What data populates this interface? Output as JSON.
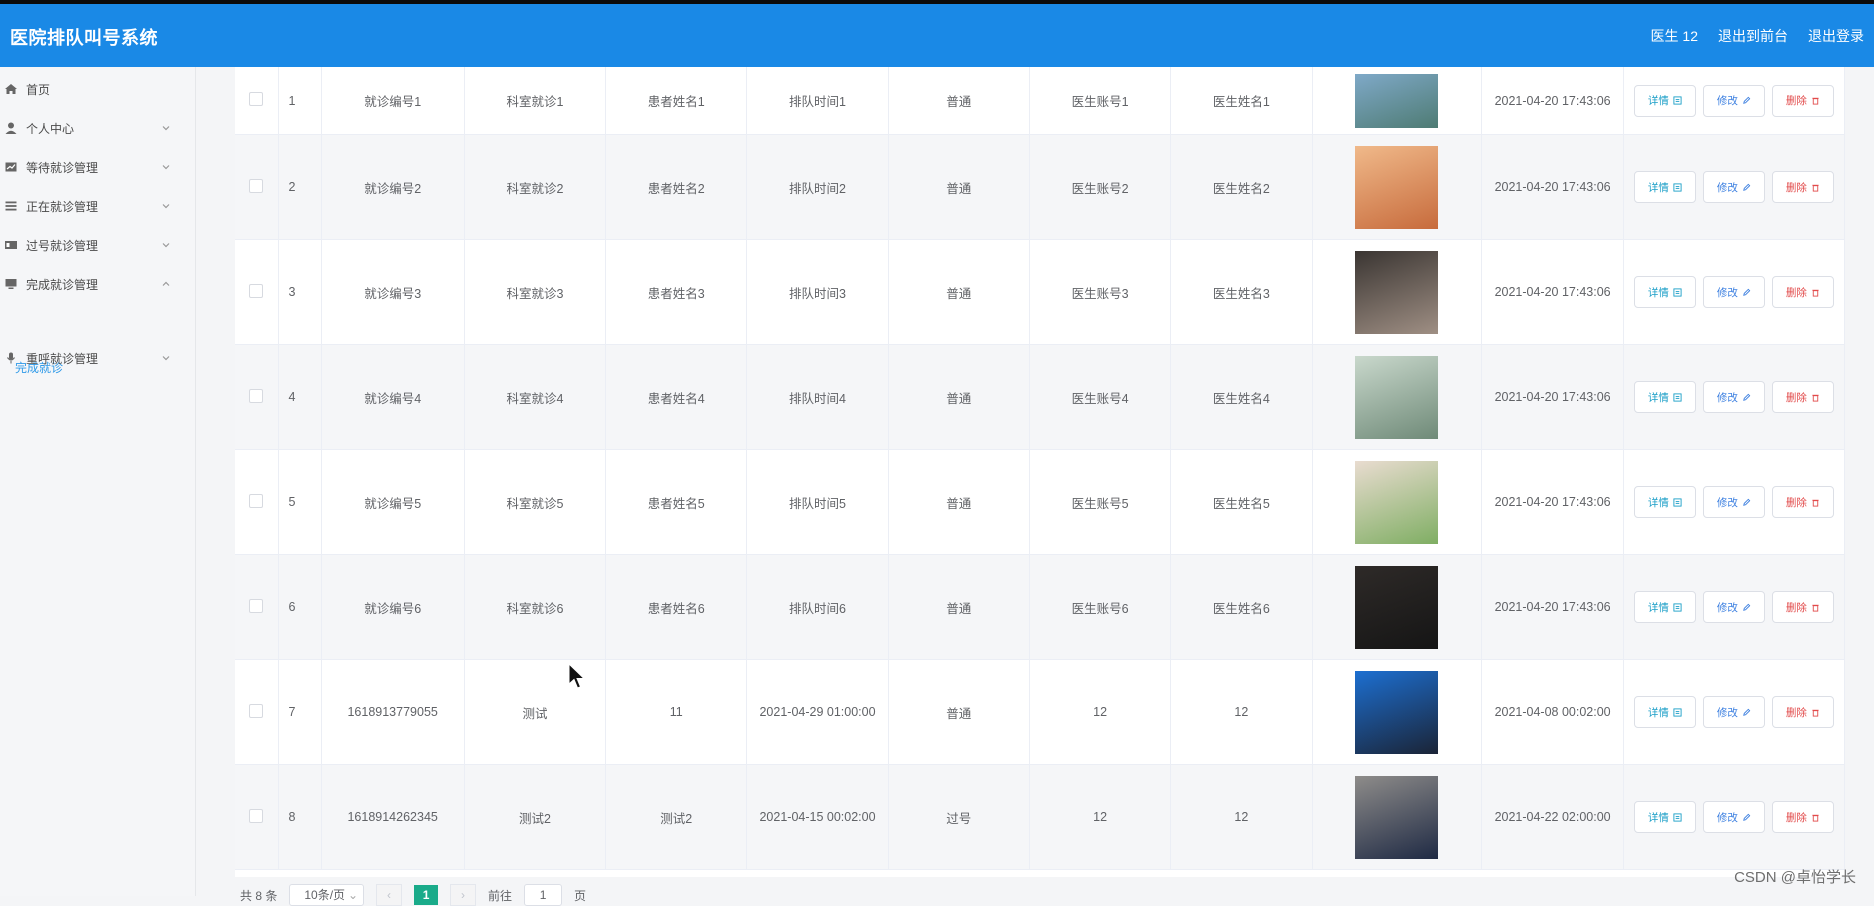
{
  "app": {
    "title": "医院排队叫号系统"
  },
  "header": {
    "user": "医生 12",
    "to_front": "退出到前台",
    "logout": "退出登录"
  },
  "sidebar": {
    "items": [
      {
        "label": "首页",
        "icon": "home-icon"
      },
      {
        "label": "个人中心",
        "icon": "user-icon"
      },
      {
        "label": "等待就诊管理",
        "icon": "chart-icon"
      },
      {
        "label": "正在就诊管理",
        "icon": "list-icon"
      },
      {
        "label": "过号就诊管理",
        "icon": "card-icon"
      },
      {
        "label": "完成就诊管理",
        "icon": "monitor-icon"
      },
      {
        "label": "重呼就诊管理",
        "icon": "mic-icon"
      }
    ],
    "active_sub": "完成就诊"
  },
  "table": {
    "rows": [
      {
        "index": "1",
        "visit_no": "就诊编号1",
        "dept": "科室就诊1",
        "patient": "患者姓名1",
        "queue_time": "排队时间1",
        "type": "普通",
        "doctor_account": "医生账号1",
        "doctor_name": "医生姓名1",
        "created": "2021-04-20 17:43:06",
        "photo_colors": [
          "#7fa9c8",
          "#4e7b73"
        ]
      },
      {
        "index": "2",
        "visit_no": "就诊编号2",
        "dept": "科室就诊2",
        "patient": "患者姓名2",
        "queue_time": "排队时间2",
        "type": "普通",
        "doctor_account": "医生账号2",
        "doctor_name": "医生姓名2",
        "created": "2021-04-20 17:43:06",
        "photo_colors": [
          "#f0b98a",
          "#c76b3c"
        ]
      },
      {
        "index": "3",
        "visit_no": "就诊编号3",
        "dept": "科室就诊3",
        "patient": "患者姓名3",
        "queue_time": "排队时间3",
        "type": "普通",
        "doctor_account": "医生账号3",
        "doctor_name": "医生姓名3",
        "created": "2021-04-20 17:43:06",
        "photo_colors": [
          "#3a3532",
          "#9f8f84"
        ]
      },
      {
        "index": "4",
        "visit_no": "就诊编号4",
        "dept": "科室就诊4",
        "patient": "患者姓名4",
        "queue_time": "排队时间4",
        "type": "普通",
        "doctor_account": "医生账号4",
        "doctor_name": "医生姓名4",
        "created": "2021-04-20 17:43:06",
        "photo_colors": [
          "#c9d8cc",
          "#6f8a78"
        ]
      },
      {
        "index": "5",
        "visit_no": "就诊编号5",
        "dept": "科室就诊5",
        "patient": "患者姓名5",
        "queue_time": "排队时间5",
        "type": "普通",
        "doctor_account": "医生账号5",
        "doctor_name": "医生姓名5",
        "created": "2021-04-20 17:43:06",
        "photo_colors": [
          "#e9dcd0",
          "#7fae63"
        ]
      },
      {
        "index": "6",
        "visit_no": "就诊编号6",
        "dept": "科室就诊6",
        "patient": "患者姓名6",
        "queue_time": "排队时间6",
        "type": "普通",
        "doctor_account": "医生账号6",
        "doctor_name": "医生姓名6",
        "created": "2021-04-20 17:43:06",
        "photo_colors": [
          "#2e2a28",
          "#151515"
        ]
      },
      {
        "index": "7",
        "visit_no": "1618913779055",
        "dept": "测试",
        "patient": "11",
        "queue_time": "2021-04-29 01:00:00",
        "type": "普通",
        "doctor_account": "12",
        "doctor_name": "12",
        "created": "2021-04-08 00:02:00",
        "photo_colors": [
          "#1c6fd1",
          "#1b2436"
        ]
      },
      {
        "index": "8",
        "visit_no": "1618914262345",
        "dept": "测试2",
        "patient": "测试2",
        "queue_time": "2021-04-15 00:02:00",
        "type": "过号",
        "doctor_account": "12",
        "doctor_name": "12",
        "created": "2021-04-22 02:00:00",
        "photo_colors": [
          "#8e8c8a",
          "#1f2a44"
        ]
      }
    ],
    "buttons": {
      "detail": "详情",
      "edit": "修改",
      "delete": "删除"
    }
  },
  "pagination": {
    "total": "共 8 条",
    "page_size": "10条/页",
    "current": "1",
    "goto_label": "前往",
    "goto_value": "1",
    "page_unit": "页"
  },
  "watermark": "CSDN @卓怡学长"
}
